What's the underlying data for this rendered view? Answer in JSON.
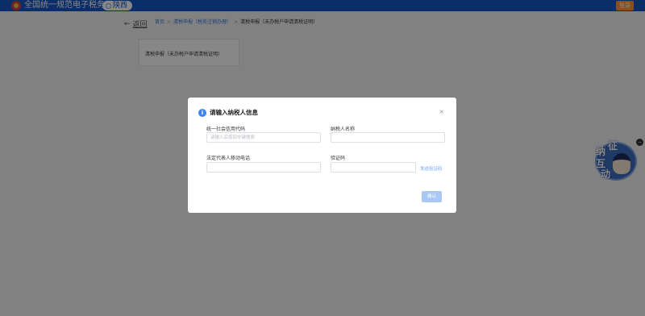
{
  "header": {
    "site_title": "全国统一规范电子税务局",
    "region": "陕西",
    "login_label": "登录"
  },
  "breadcrumb": {
    "back_arrow": "←",
    "back_label": "返回",
    "items": [
      "首页",
      "清税申报（税务注销办理）",
      "清税申报（未办税户申请清税证明）"
    ],
    "separator": ">"
  },
  "card": {
    "label": "清税申报（未办税户申请清税证明）"
  },
  "modal": {
    "title": "请输入纳税人信息",
    "info_glyph": "i",
    "close_glyph": "×",
    "fields": {
      "credit_code": {
        "label": "统一社会信用代码",
        "placeholder": "请输入后按回车键搜索",
        "value": ""
      },
      "taxpayer_name": {
        "label": "纳税人名称",
        "value": ""
      },
      "legal_phone": {
        "label": "法定代表人移动电话",
        "value": ""
      },
      "captcha": {
        "label": "验证码",
        "value": ""
      }
    },
    "send_captcha_label": "发送验证码",
    "confirm_label": "确认"
  },
  "float_widget": {
    "chars": [
      "纳",
      "征",
      "互",
      "动"
    ],
    "close_glyph": "−"
  },
  "colors": {
    "header_bg": "#1558c7",
    "accent": "#3f84ef",
    "login_bg": "#ff9a2e",
    "confirm_bg": "#a9c9f4"
  }
}
